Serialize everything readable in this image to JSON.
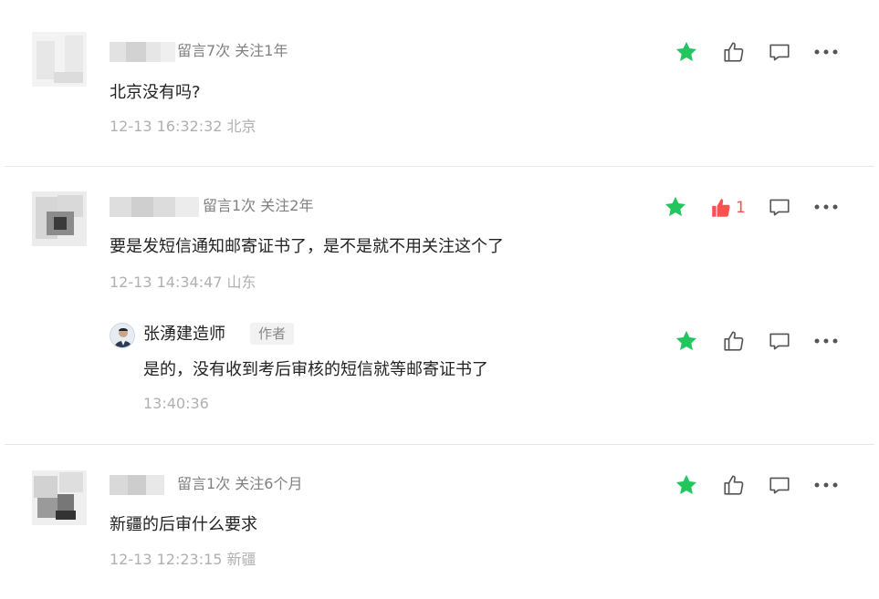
{
  "colors": {
    "star": "#23c55e",
    "like_active": "#fa5151",
    "icon": "#555555",
    "meta": "#808080",
    "time": "#b0b0b0"
  },
  "comments": [
    {
      "meta": "留言7次 关注1年",
      "content": "北京没有吗?",
      "time": "12-13 16:32:32 北京",
      "likes": ""
    },
    {
      "meta": "留言1次 关注2年",
      "content": "要是发短信通知邮寄证书了，是不是就不用关注这个了",
      "time": "12-13 14:34:47 山东",
      "likes": "1",
      "reply": {
        "author": "张湧建造师",
        "badge": "作者",
        "content": "是的，没有收到考后审核的短信就等邮寄证书了",
        "time": "13:40:36"
      }
    },
    {
      "meta": "留言1次 关注6个月",
      "content": "新疆的后审什么要求",
      "time": "12-13 12:23:15 新疆",
      "likes": ""
    }
  ],
  "icons": [
    "star-icon",
    "thumbs-up-icon",
    "comment-icon",
    "more-icon"
  ]
}
